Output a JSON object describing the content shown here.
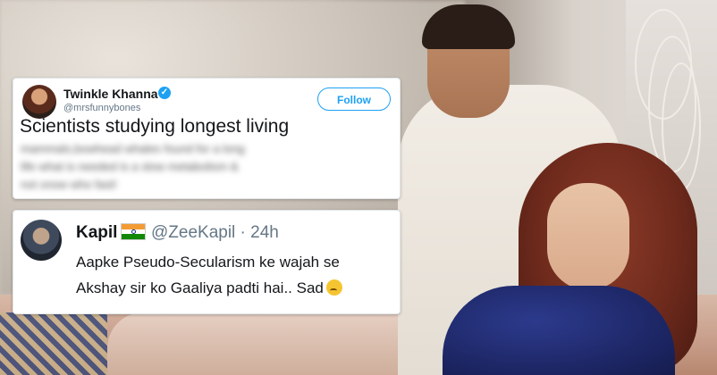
{
  "tweet_primary": {
    "name": "Twinkle Khanna",
    "handle": "@mrsfunnybones",
    "follow_label": "Follow",
    "text": "Scientists studying longest living",
    "blurred_lines": [
      "mammals,bowhead whales found for a long",
      "life what is needed is a slow metabolism &",
      "not xnow who fast!"
    ]
  },
  "tweet_reply": {
    "name": "Kapil",
    "handle_time": "@ZeeKapil · 24h",
    "lines": [
      "Aapke Pseudo-Secularism ke wajah se",
      "Akshay sir ko Gaaliya padti hai.. Sad"
    ],
    "emoji": "thinking-face-icon"
  },
  "colors": {
    "twitter_blue": "#1da1f2",
    "text_primary": "#14171a",
    "text_secondary": "#657786"
  }
}
